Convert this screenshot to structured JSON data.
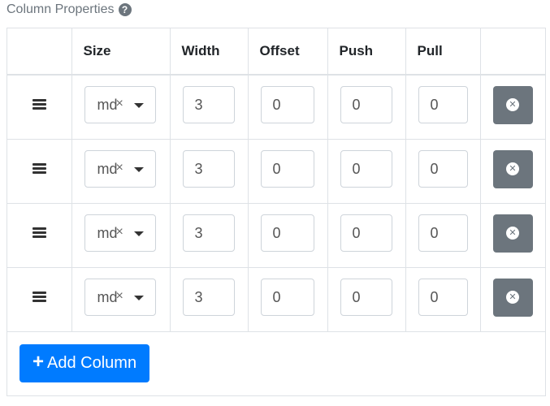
{
  "panel": {
    "title": "Column Properties",
    "help_icon": "?"
  },
  "table": {
    "headers": [
      "",
      "Size",
      "Width",
      "Offset",
      "Push",
      "Pull",
      ""
    ],
    "rows": [
      {
        "size": "md",
        "width": "3",
        "offset": "0",
        "push": "0",
        "pull": "0"
      },
      {
        "size": "md",
        "width": "3",
        "offset": "0",
        "push": "0",
        "pull": "0"
      },
      {
        "size": "md",
        "width": "3",
        "offset": "0",
        "push": "0",
        "pull": "0"
      },
      {
        "size": "md",
        "width": "3",
        "offset": "0",
        "push": "0",
        "pull": "0"
      }
    ]
  },
  "select": {
    "clear_glyph": "×"
  },
  "add_button": {
    "label": "Add Column",
    "icon": "+"
  },
  "colors": {
    "primary": "#007bff",
    "secondary": "#6c757d",
    "border": "#dee2e6"
  },
  "icons": {
    "drag": "drag-handle-icon",
    "remove": "remove-circle-icon",
    "help": "question-circle-icon",
    "plus": "plus-icon"
  }
}
